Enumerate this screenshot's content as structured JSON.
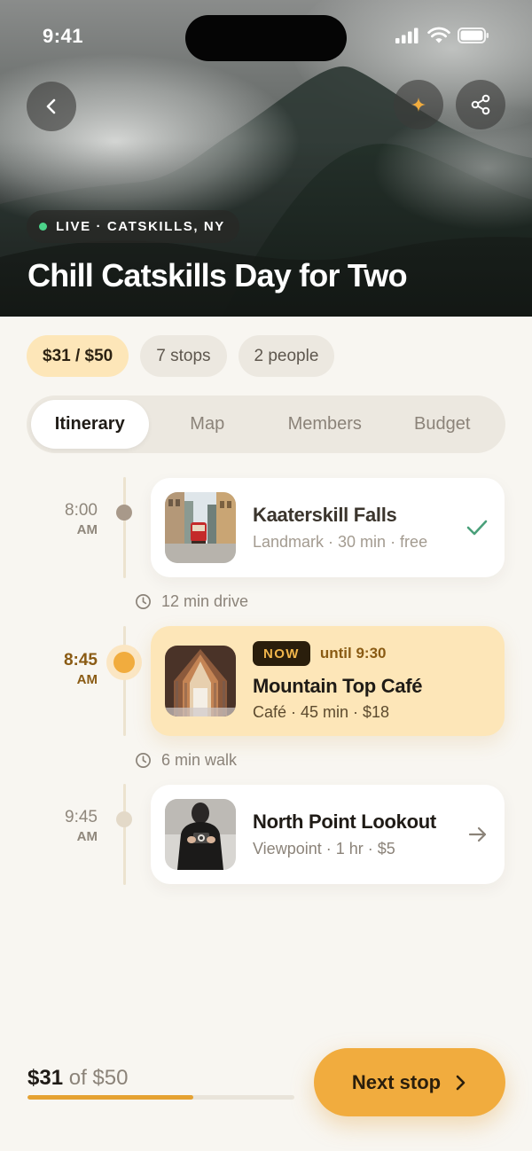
{
  "status_bar": {
    "time": "9:41"
  },
  "hero": {
    "live_label": "LIVE · CATSKILLS, NY",
    "title": "Chill Catskills Day for Two"
  },
  "chips": {
    "budget": "$31 / $50",
    "stops": "7 stops",
    "people": "2 people"
  },
  "tabs": [
    {
      "label": "Itinerary",
      "active": true
    },
    {
      "label": "Map",
      "active": false
    },
    {
      "label": "Members",
      "active": false
    },
    {
      "label": "Budget",
      "active": false
    }
  ],
  "itinerary": [
    {
      "time": "8:00",
      "ampm": "AM",
      "status": "done",
      "name": "Kaaterskill Falls",
      "meta": "Landmark · 30 min · free",
      "trail_icon": "check-icon"
    },
    {
      "time": "8:45",
      "ampm": "AM",
      "status": "now",
      "now_badge": "NOW",
      "until": "until 9:30",
      "name": "Mountain Top Café",
      "meta": "Café · 45 min · $18"
    },
    {
      "time": "9:45",
      "ampm": "AM",
      "status": "upcoming",
      "name": "North Point Lookout",
      "meta": "Viewpoint · 1 hr · $5",
      "trail_icon": "arrow-right-icon"
    }
  ],
  "transit": [
    {
      "label": "12 min drive"
    },
    {
      "label": "6 min walk"
    }
  ],
  "footer": {
    "spent_amount": "$31",
    "spent_suffix": " of $50",
    "progress_fraction": 0.62,
    "next_label": "Next stop"
  },
  "colors": {
    "accent": "#f1ac3e",
    "now_card": "#fde6b8",
    "live_dot": "#4cd38a",
    "check": "#4aa07a"
  }
}
